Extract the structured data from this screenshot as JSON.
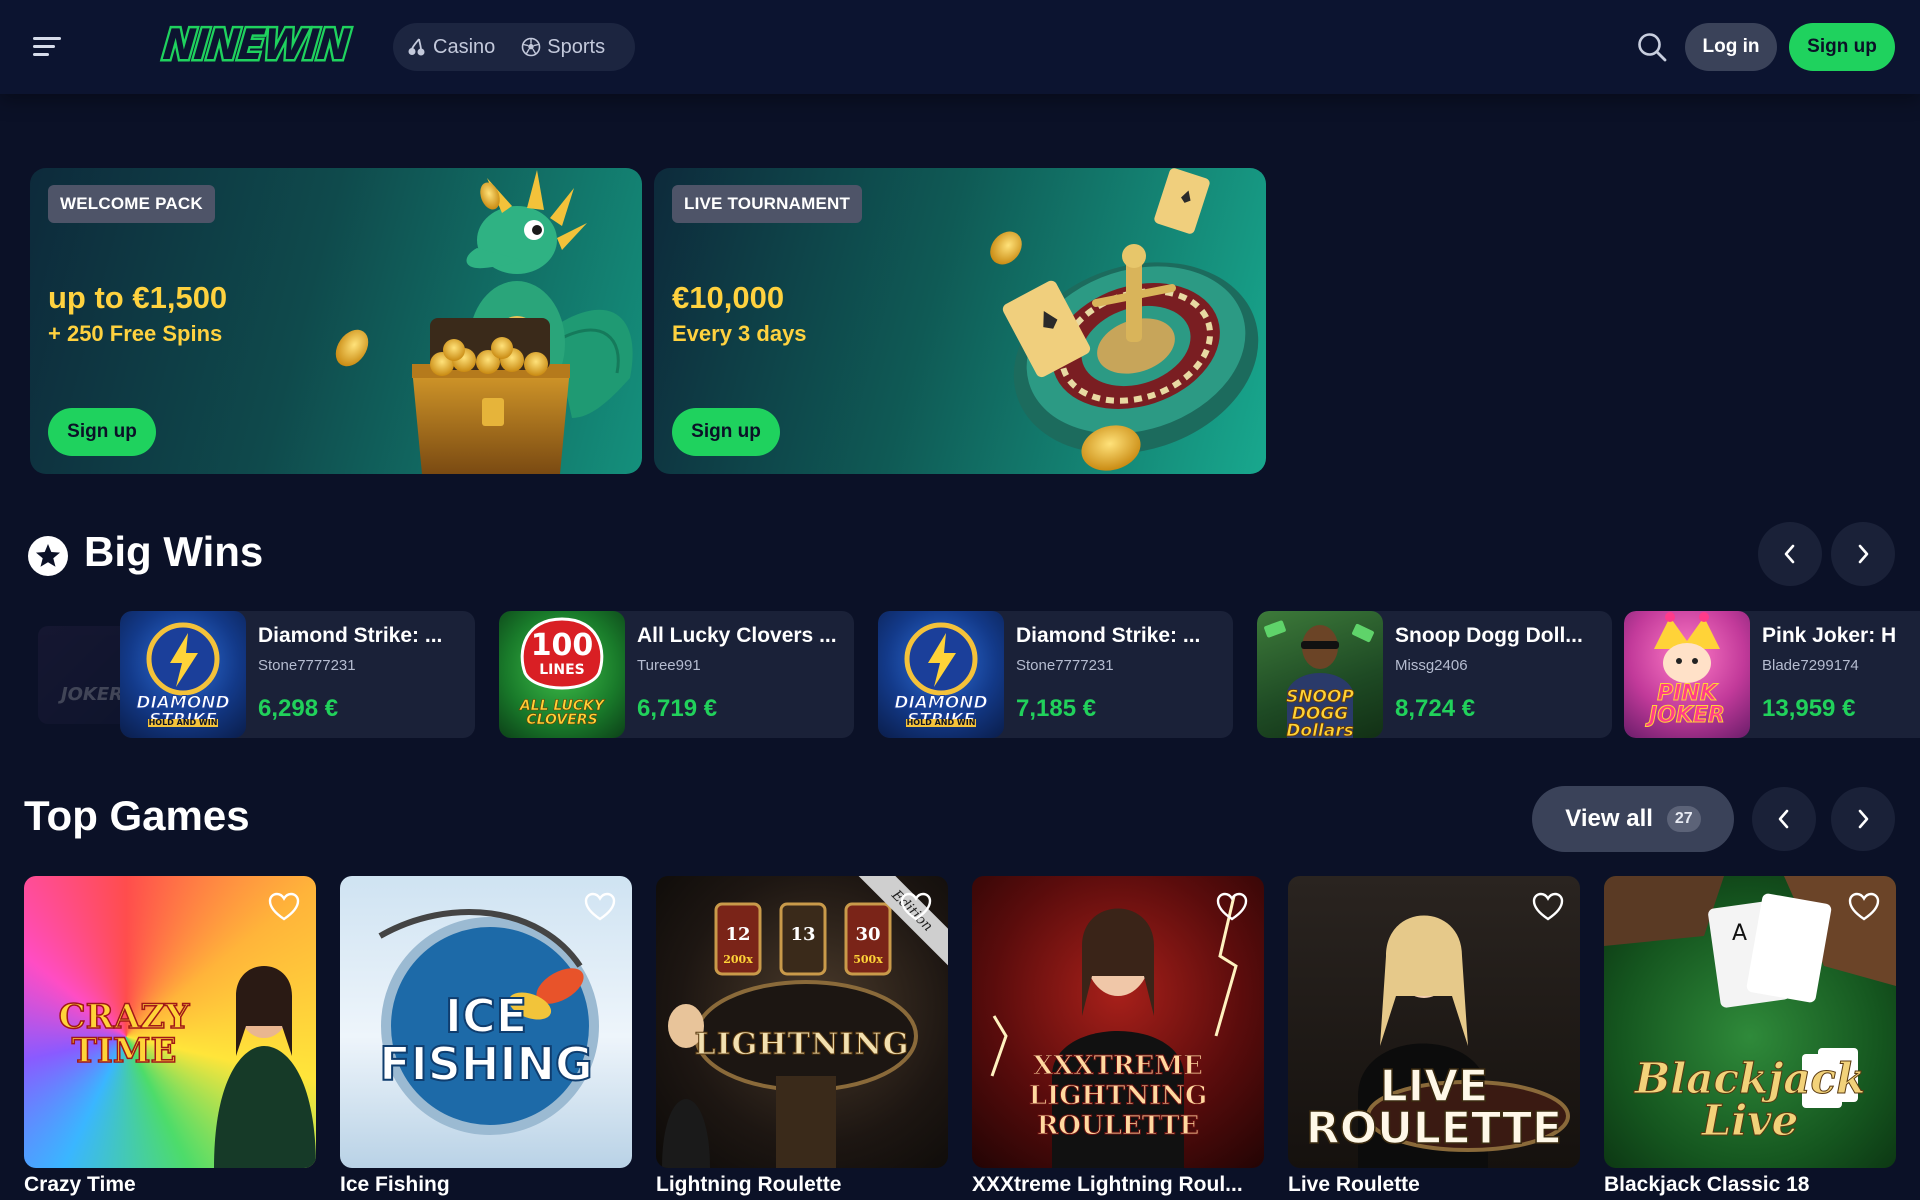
{
  "header": {
    "logo_text": "NINEWIN",
    "nav": [
      {
        "label": "Casino",
        "icon": "cherry-icon"
      },
      {
        "label": "Sports",
        "icon": "soccer-ball-icon"
      }
    ],
    "login_label": "Log in",
    "signup_label": "Sign up"
  },
  "promos": [
    {
      "badge": "WELCOME PACK",
      "amount": "up to €1,500",
      "sub": "+ 250 Free Spins",
      "cta": "Sign up"
    },
    {
      "badge": "LIVE TOURNAMENT",
      "amount": "€10,000",
      "sub": "Every 3 days",
      "cta": "Sign up"
    }
  ],
  "big_wins": {
    "title": "Big Wins",
    "items": [
      {
        "game": "Diamond Strike: ...",
        "user": "Stone7777231",
        "amount": "6,298 €"
      },
      {
        "game": "All Lucky Clovers ...",
        "user": "Turee991",
        "amount": "6,719 €"
      },
      {
        "game": "Diamond Strike: ...",
        "user": "Stone7777231",
        "amount": "7,185 €"
      },
      {
        "game": "Snoop Dogg Doll...",
        "user": "Missg2406",
        "amount": "8,724 €"
      },
      {
        "game": "Pink Joker: H",
        "user": "Blade7299174",
        "amount": "13,959 €"
      }
    ],
    "thumbs": {
      "diamond": "DIAMOND STRIKE",
      "diamond_sub": "HOLD AND WIN",
      "lucky_top": "100",
      "lucky_mid": "LINES",
      "lucky_bottom": "ALL LUCKY CLOVERS",
      "snoop": "SNOOP DOGG Dollars",
      "pink": "PINK JOKER",
      "faded": "JOKER"
    }
  },
  "top_games": {
    "title": "Top Games",
    "view_all_label": "View all",
    "view_all_count": "27",
    "items": [
      {
        "name": "Crazy Time",
        "logo": "CRAZY TIME"
      },
      {
        "name": "Ice Fishing",
        "logo": "ICE FISHING"
      },
      {
        "name": "Lightning Roulette",
        "logo": "LIGHTNING"
      },
      {
        "name": "XXXtreme Lightning Roul...",
        "logo": "XXXTREME LIGHTNING ROULETTE"
      },
      {
        "name": "Live Roulette",
        "logo": "LIVE ROULETTE"
      },
      {
        "name": "Blackjack Classic 18",
        "logo": "Blackjack Live"
      }
    ],
    "lightning_numbers": [
      "12",
      "13",
      "30"
    ],
    "lightning_multipliers": [
      "200x",
      "500x"
    ],
    "lightning_ribbon": "Edition"
  },
  "colors": {
    "background": "#0b1127",
    "accent_green": "#1fd25e",
    "win_green": "#21d15b",
    "promo_yellow": "#ffd23f",
    "card_bg": "#1a2138"
  }
}
